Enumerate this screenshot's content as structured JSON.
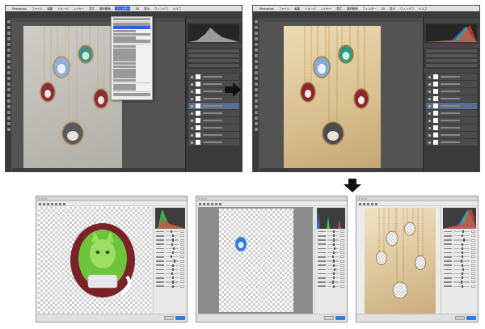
{
  "app": {
    "name": "Photoshop",
    "menus": [
      "ファイル",
      "編集",
      "イメージ",
      "レイヤー",
      "書式",
      "選択範囲",
      "フィルター",
      "3D",
      "表示",
      "ウィンドウ",
      "ヘルプ"
    ],
    "active_menu": "フィルター"
  },
  "colors": {
    "workspace": "#535353",
    "panel": "#3a3a3a",
    "menu_highlight": "#2d62d8",
    "ok_button": "#2f7be6"
  },
  "icons": [
    "arrow-right-icon",
    "arrow-down-icon"
  ]
}
